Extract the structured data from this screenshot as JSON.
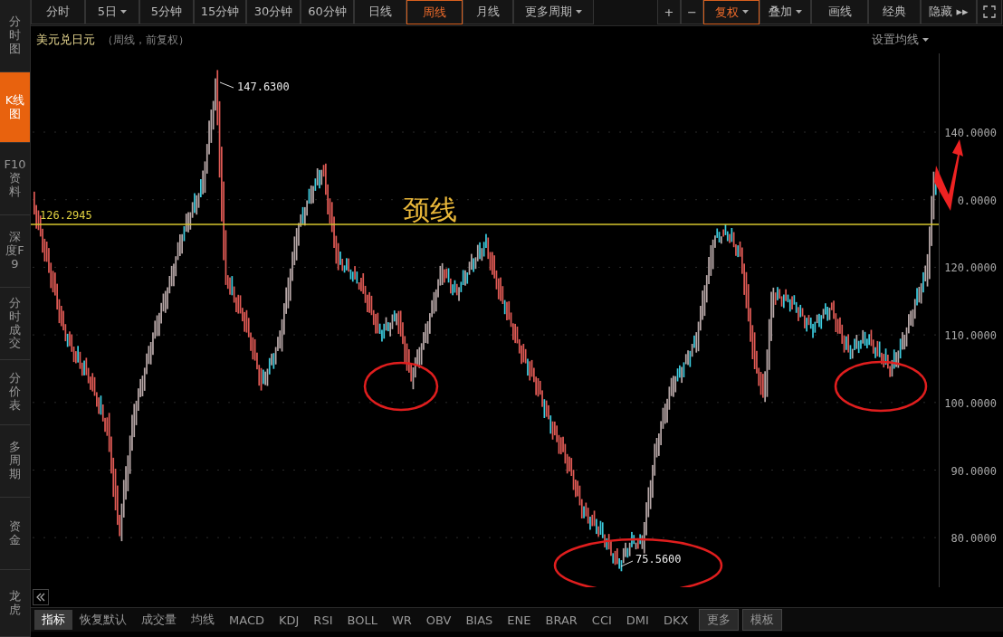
{
  "sidebar": {
    "items": [
      {
        "label": "分时图",
        "selected": false
      },
      {
        "label": "K线图",
        "selected": true
      },
      {
        "label": "F10资料",
        "selected": false
      },
      {
        "label": "深度F9",
        "selected": false
      },
      {
        "label": "分时成交",
        "selected": false
      },
      {
        "label": "分价表",
        "selected": false
      },
      {
        "label": "多周期",
        "selected": false
      },
      {
        "label": "资金",
        "selected": false
      },
      {
        "label": "龙虎",
        "selected": false
      }
    ]
  },
  "toolbar": {
    "periods": [
      {
        "label": "分时",
        "selected": false,
        "menu": false
      },
      {
        "label": "5日",
        "selected": false,
        "menu": true
      },
      {
        "label": "5分钟",
        "selected": false,
        "menu": false
      },
      {
        "label": "15分钟",
        "selected": false,
        "menu": false
      },
      {
        "label": "30分钟",
        "selected": false,
        "menu": false
      },
      {
        "label": "60分钟",
        "selected": false,
        "menu": false
      },
      {
        "label": "日线",
        "selected": false,
        "menu": false
      },
      {
        "label": "周线",
        "selected": true,
        "menu": false
      },
      {
        "label": "月线",
        "selected": false,
        "menu": false
      },
      {
        "label": "更多周期",
        "selected": false,
        "menu": true
      }
    ],
    "tools": [
      {
        "label": "+",
        "selected": false,
        "menu": false
      },
      {
        "label": "−",
        "selected": false,
        "menu": false
      },
      {
        "label": "复权",
        "selected": true,
        "menu": true
      },
      {
        "label": "叠加",
        "selected": false,
        "menu": true
      },
      {
        "label": "画线",
        "selected": false,
        "menu": false
      },
      {
        "label": "经典",
        "selected": false,
        "menu": false
      },
      {
        "label": "隐藏 ▸▸",
        "selected": false,
        "menu": false
      }
    ]
  },
  "header": {
    "symbol": "美元兑日元",
    "info": "（周线，前复权）",
    "ma_setting": "设置均线"
  },
  "chart": {
    "y_ticks": [
      "140.0000",
      "0.0000",
      "120.0000",
      "110.0000",
      "100.0000",
      "90.0000",
      "80.0000"
    ],
    "high_label": "147.6300",
    "low_label": "75.5600",
    "neckline_value": "126.2945",
    "neckline_label": "颈线"
  },
  "indicator_tabs": [
    {
      "label": "指标",
      "kind": "tab",
      "selected": true
    },
    {
      "label": "恢复默认",
      "kind": "tab",
      "selected": false
    },
    {
      "label": "成交量",
      "kind": "tab",
      "selected": false
    },
    {
      "label": "均线",
      "kind": "tab",
      "selected": false
    },
    {
      "label": "MACD",
      "kind": "tab",
      "selected": false
    },
    {
      "label": "KDJ",
      "kind": "tab",
      "selected": false
    },
    {
      "label": "RSI",
      "kind": "tab",
      "selected": false
    },
    {
      "label": "BOLL",
      "kind": "tab",
      "selected": false
    },
    {
      "label": "WR",
      "kind": "tab",
      "selected": false
    },
    {
      "label": "OBV",
      "kind": "tab",
      "selected": false
    },
    {
      "label": "BIAS",
      "kind": "tab",
      "selected": false
    },
    {
      "label": "ENE",
      "kind": "tab",
      "selected": false
    },
    {
      "label": "BRAR",
      "kind": "tab",
      "selected": false
    },
    {
      "label": "CCI",
      "kind": "tab",
      "selected": false
    },
    {
      "label": "DMI",
      "kind": "tab",
      "selected": false
    },
    {
      "label": "DKX",
      "kind": "tab",
      "selected": false
    },
    {
      "label": "更多",
      "kind": "button",
      "selected": false
    },
    {
      "label": "模板",
      "kind": "button",
      "selected": false
    }
  ]
}
